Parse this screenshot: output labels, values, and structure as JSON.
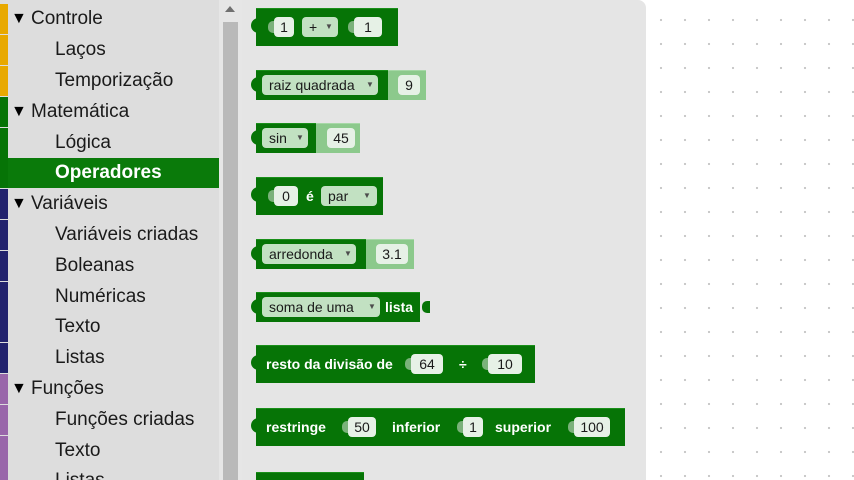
{
  "sidebar": {
    "colors": {
      "controle": "#e8a900",
      "matematica": "#067406",
      "variaveis": "#22226e",
      "funcoes": "#9966aa",
      "selected_bg": "#0a7a0a"
    },
    "items": [
      {
        "label": "Controle",
        "expanded": true
      },
      {
        "label": "Laços"
      },
      {
        "label": "Temporização"
      },
      {
        "label": "Matemática",
        "expanded": true
      },
      {
        "label": "Lógica"
      },
      {
        "label": "Operadores",
        "selected": true
      },
      {
        "label": "Variáveis",
        "expanded": true
      },
      {
        "label": "Variáveis criadas"
      },
      {
        "label": "Boleanas"
      },
      {
        "label": "Numéricas"
      },
      {
        "label": "Texto"
      },
      {
        "label": "Listas"
      },
      {
        "label": "Funções",
        "expanded": true
      },
      {
        "label": "Funções criadas"
      },
      {
        "label": "Texto"
      },
      {
        "label": "Listas"
      }
    ],
    "expand_glyph": "▼"
  },
  "flyout": {
    "block_color": "#067406",
    "shadow_color": "#8cc98c",
    "blocks": {
      "arith": {
        "a": "1",
        "op": "+",
        "b": "1"
      },
      "sqrt": {
        "func": "raiz quadrada",
        "value": "9"
      },
      "trig": {
        "func": "sin",
        "value": "45"
      },
      "parity": {
        "value": "0",
        "is": "é",
        "prop": "par"
      },
      "round": {
        "func": "arredonda",
        "value": "3.1"
      },
      "list": {
        "func": "soma de uma",
        "suffix": "lista"
      },
      "mod": {
        "label": "resto da divisão de",
        "a": "64",
        "op": "÷",
        "b": "10"
      },
      "constrain": {
        "label": "restringe",
        "value": "50",
        "low_label": "inferior",
        "low": "1",
        "high_label": "superior",
        "high": "100"
      }
    }
  },
  "icons": {
    "dropdown_caret": "▼",
    "scroll_up": "triangle-up"
  }
}
